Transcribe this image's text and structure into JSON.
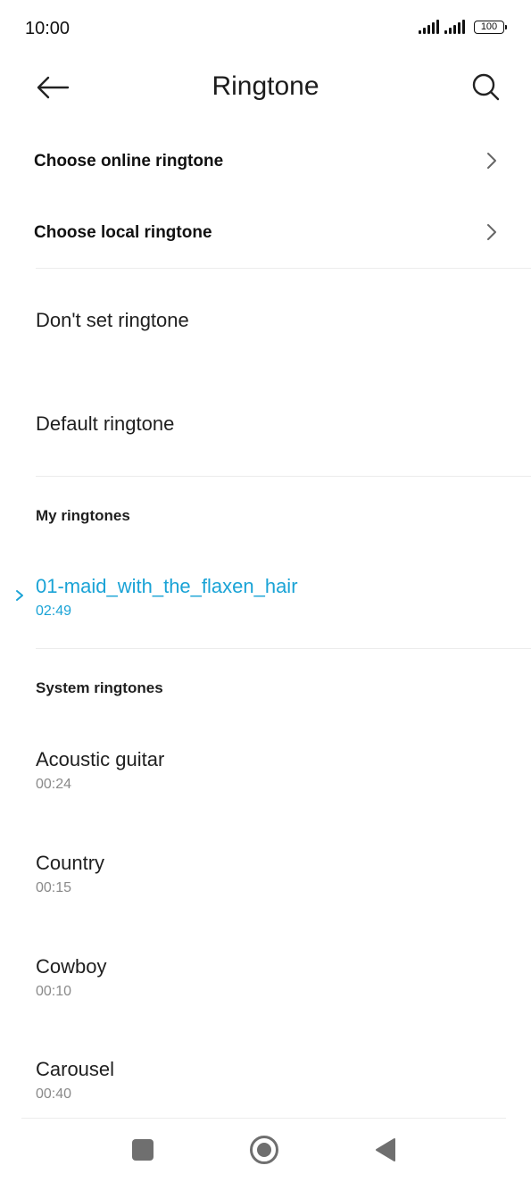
{
  "status_bar": {
    "time": "10:00",
    "battery": "100",
    "icons": [
      "signal-icon",
      "signal-icon",
      "battery-icon"
    ]
  },
  "header": {
    "title": "Ringtone",
    "back_icon": "back-arrow-icon",
    "search_icon": "search-icon"
  },
  "links": [
    {
      "label": "Choose online ringtone",
      "icon": "chevron-right-icon"
    },
    {
      "label": "Choose local ringtone",
      "icon": "chevron-right-icon"
    }
  ],
  "options": [
    {
      "label": "Don't set ringtone"
    },
    {
      "label": "Default ringtone"
    }
  ],
  "my_ringtones": {
    "header": "My ringtones",
    "items": [
      {
        "name": "01-maid_with_the_flaxen_hair",
        "duration": "02:49",
        "selected": true
      }
    ]
  },
  "system_ringtones": {
    "header": "System ringtones",
    "items": [
      {
        "name": "Acoustic guitar",
        "duration": "00:24"
      },
      {
        "name": "Country",
        "duration": "00:15"
      },
      {
        "name": "Cowboy",
        "duration": "00:10"
      },
      {
        "name": "Carousel",
        "duration": "00:40"
      }
    ]
  },
  "nav_bar": {
    "icons": [
      "recents-icon",
      "home-icon",
      "back-icon"
    ]
  },
  "colors": {
    "accent": "#1aa3d6",
    "text": "#1f1f1f",
    "secondary_text": "#8a8a8a",
    "divider": "#ececec"
  }
}
